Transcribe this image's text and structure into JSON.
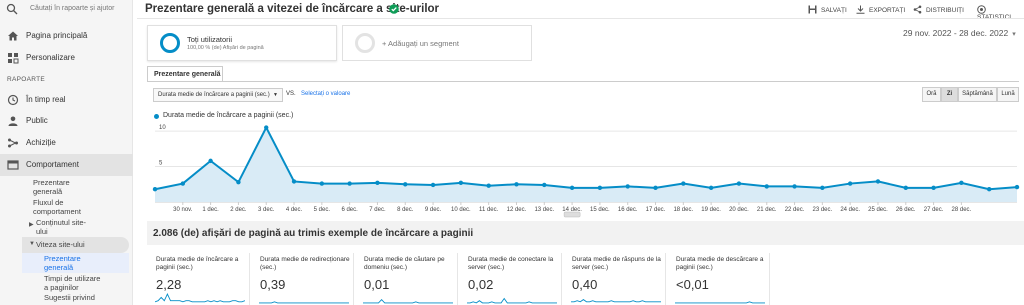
{
  "sidebar": {
    "search_placeholder": "Căutați în rapoarte și ajutor",
    "home": "Pagina principală",
    "customization": "Personalizare",
    "reports_header": "RAPOARTE",
    "realtime": "În timp real",
    "audience": "Public",
    "acquisition": "Achiziție",
    "behavior": "Comportament",
    "behavior_sub": {
      "overview_l1": "Prezentare",
      "overview_l2": "generală",
      "flow_l1": "Fluxul de",
      "flow_l2": "comportament",
      "content_l1": "Conținutul site-",
      "content_l2": "ului",
      "speed": "Viteza site-ului",
      "speed_overview_l1": "Prezentare",
      "speed_overview_l2": "generală",
      "timings_l1": "Timpi de utilizare",
      "timings_l2": "a paginilor",
      "suggestions_l1": "Sugestii privind"
    }
  },
  "header": {
    "title": "Prezentare generală a vitezei de încărcare a site-urilor",
    "save": "SALVAȚI",
    "export": "EXPORTAȚI",
    "share": "DISTRIBUIȚI",
    "insights": "STATISTICI"
  },
  "segments": {
    "seg1_name": "Toți utilizatorii",
    "seg1_desc": "100,00 % (de) Afișări de pagină",
    "add_segment": "+ Adăugați un segment"
  },
  "date_range": "29 nov. 2022 - 28 dec. 2022",
  "tab": "Prezentare generală",
  "controls": {
    "metric": "Durata medie de încărcare a paginii (sec.)",
    "vs": "VS.",
    "select_value": "Selectați o valoare",
    "granularity": [
      "Oră",
      "Zi",
      "Săptămână",
      "Lună"
    ],
    "granularity_selected": "Zi"
  },
  "chart_data": {
    "type": "line",
    "series": [
      {
        "name": "Durata medie de încărcare a paginii (sec.)",
        "values": [
          1.8,
          2.6,
          5.8,
          2.8,
          10.5,
          2.9,
          2.6,
          2.6,
          2.7,
          2.5,
          2.4,
          2.7,
          2.3,
          2.5,
          2.4,
          2.0,
          2.0,
          2.2,
          2.0,
          2.6,
          2.0,
          2.6,
          2.2,
          2.2,
          2.0,
          2.6,
          2.9,
          2.0,
          2.0,
          2.7,
          1.8,
          2.1
        ]
      }
    ],
    "x_tick_labels": [
      "30 nov.",
      "1 dec.",
      "2 dec.",
      "3 dec.",
      "4 dec.",
      "5 dec.",
      "6 dec.",
      "7 dec.",
      "8 dec.",
      "9 dec.",
      "10 dec.",
      "11 dec.",
      "12 dec.",
      "13 dec.",
      "14 dec.",
      "15 dec.",
      "16 dec.",
      "17 dec.",
      "18 dec.",
      "19 dec.",
      "20 dec.",
      "21 dec.",
      "22 dec.",
      "23 dec.",
      "24 dec.",
      "25 dec.",
      "26 dec.",
      "27 dec.",
      "28 dec."
    ],
    "y_ticks": [
      "10",
      "5"
    ],
    "ylim": [
      0,
      11
    ],
    "color": "#058dc7",
    "fill": "#d9ebf6"
  },
  "section_title": "2.086 (de) afișări de pagină au trimis exemple de încărcare a paginii",
  "kpis": [
    {
      "label": "Durata medie de încărcare a paginii (sec.)",
      "value": "2,28"
    },
    {
      "label": "Durata medie de redirecționare (sec.)",
      "value": "0,39"
    },
    {
      "label": "Durata medie de căutare pe domeniu (sec.)",
      "value": "0,01"
    },
    {
      "label": "Durata medie de conectare la server (sec.)",
      "value": "0,02"
    },
    {
      "label": "Durata medie de răspuns de la server (sec.)",
      "value": "0,40"
    },
    {
      "label": "Durata medie de descărcare a paginii (sec.)",
      "value": "<0,01"
    }
  ],
  "colors": {
    "accent": "#058dc7",
    "link": "#1a73e8",
    "verified": "#0f9d58"
  }
}
